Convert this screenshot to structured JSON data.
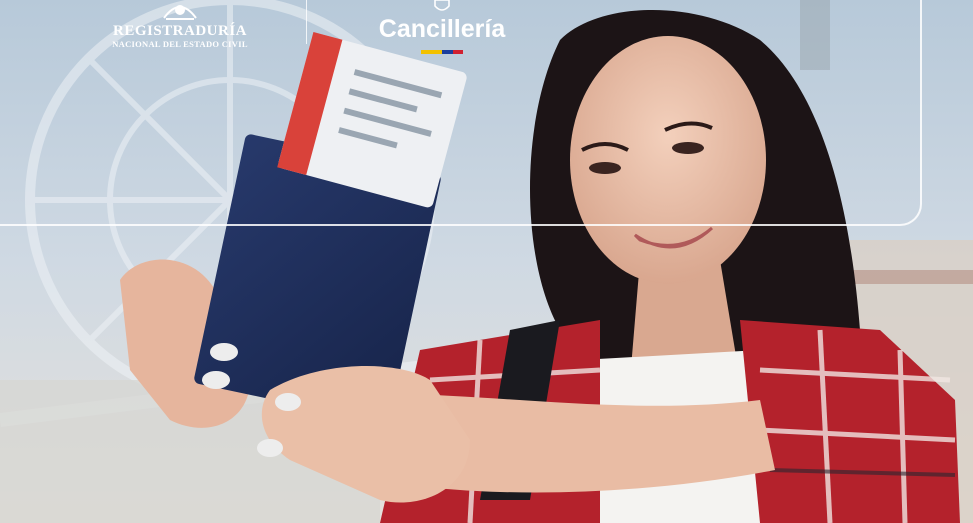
{
  "header": {
    "registraduria": {
      "title": "REGISTRADURÍA",
      "subtitle": "NACIONAL DEL ESTADO CIVIL"
    },
    "cancilleria": {
      "title": "Cancillería"
    }
  },
  "colors": {
    "flag_yellow": "#f2c100",
    "flag_blue": "#1b3f9e",
    "flag_red": "#d12030",
    "passport": "#1e2f5e",
    "ticket_red": "#d9423a",
    "shirt_red": "#b4222c"
  },
  "scene": {
    "description_icon": "woman-holding-passport-photo"
  }
}
